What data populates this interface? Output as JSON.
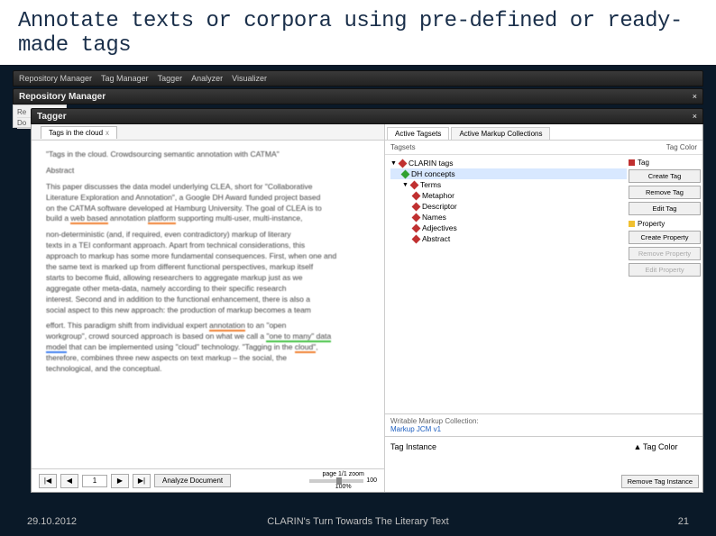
{
  "slide": {
    "title": "Annotate texts or corpora using pre-defined or ready-made tags",
    "date": "29.10.2012",
    "footer_center": "CLARIN's Turn Towards The Literary Text",
    "page_number": "21"
  },
  "bars": {
    "bar1_tabs": [
      "Repository Manager",
      "Tag Manager",
      "Tagger",
      "Analyzer",
      "Visualizer"
    ],
    "bar2_title": "Repository Manager",
    "bar2_sub": [
      "Re",
      "Do"
    ],
    "bar3_title": "Tagger",
    "close": "×"
  },
  "tagger": {
    "tab_label": "Tags in the cloud",
    "tab_close": "x"
  },
  "doc": {
    "p1a": "\"Tags in the cloud. Crowdsourcing semantic annotation with CATMA\"",
    "p2": "Abstract",
    "p3a": "This paper discusses the data model underlying CLEA, short for \"Collaborative",
    "p3b": "Literature Exploration and Annotation\", a Google DH Award funded project based",
    "p3c": "on the CATMA software developed at Hamburg University. The goal of CLEA is to",
    "p3d_a": "build a ",
    "p3d_b": "web based",
    "p3d_c": " annotation ",
    "p3d_d": "platform",
    "p3d_e": " supporting multi-user, multi-instance,",
    "p4a": "non-deterministic (and, if required, even contradictory) markup of literary",
    "p4b": "texts in a TEI conformant approach. Apart from technical considerations, this",
    "p4c": "approach to markup has some more fundamental consequences. First, when one and",
    "p4d": "the same text is marked up from different functional perspectives, markup itself",
    "p4e": "starts to become fluid, allowing researchers to aggregate markup just as we",
    "p4f": "aggregate other meta-data, namely according to their specific research",
    "p4g": "interest. Second and in addition to the functional enhancement, there is also a",
    "p4h": "social aspect to this new approach: the production of markup becomes a team",
    "p5a_a": "effort. This paradigm shift from individual expert ",
    "p5a_b": "annotation",
    "p5a_c": " to an \"open",
    "p5b_a": "workgroup\", crowd sourced approach is based on what we call a ",
    "p5b_b": "\"one to many\" data",
    "p5c_a": "model",
    "p5c_b": " that can be implemented using \"cloud\" technology. \"Tagging in the ",
    "p5c_c": "cloud\"",
    "p5c_d": ",",
    "p5d": "therefore, combines three new aspects on text markup – the social, the",
    "p5e": "technological, and the conceptual."
  },
  "nav": {
    "first": "|◀",
    "prev": "◀",
    "page": "1",
    "next": "▶",
    "last": "▶|",
    "analyze": "Analyze Document",
    "page_info": "page 1/1 zoom",
    "zoom_val": "100%",
    "zoom_max": "100"
  },
  "right": {
    "tab1": "Active Tagsets",
    "tab2": "Active Markup Collections",
    "col_tagsets": "Tagsets",
    "col_color": "Tag Color",
    "tree": {
      "root": "CLARIN tags",
      "n1": "DH concepts",
      "n2": "Terms",
      "n3": "Metaphor",
      "n4": "Descriptor",
      "n5": "Names",
      "n6": "Adjectives",
      "n7": "Abstract"
    },
    "btns": {
      "tag_label": "Tag",
      "create_tag": "Create Tag",
      "remove_tag": "Remove Tag",
      "edit_tag": "Edit Tag",
      "prop_label": "Property",
      "create_prop": "Create Property",
      "remove_prop": "Remove Property",
      "edit_prop": "Edit Property"
    },
    "writable_label": "Writable Markup Collection:",
    "writable_value": "Markup JCM v1",
    "instance_col": "Tag Instance",
    "instance_arrow": "▲",
    "instance_color": "Tag Color",
    "remove_instance": "Remove Tag Instance"
  }
}
